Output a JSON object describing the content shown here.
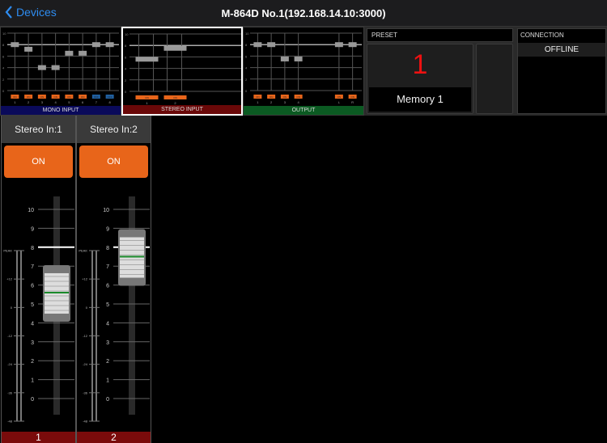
{
  "navbar": {
    "back_label": "Devices",
    "title": "M-864D No.1(192.168.14.10:3000)"
  },
  "overview": {
    "scale_labels": [
      "10",
      "8",
      "6",
      "4",
      "2",
      "0"
    ],
    "panels": [
      {
        "id": "mono",
        "label": "MONO INPUT",
        "color": "#0a0a5a",
        "selected": false,
        "channels": [
          {
            "name": "1",
            "level": 8.0,
            "on": true
          },
          {
            "name": "2",
            "level": 7.2,
            "on": true
          },
          {
            "name": "3",
            "level": 4.0,
            "on": true
          },
          {
            "name": "4",
            "level": 4.0,
            "on": true
          },
          {
            "name": "5",
            "level": 6.5,
            "on": true
          },
          {
            "name": "6",
            "level": 6.5,
            "on": true
          },
          {
            "name": "7",
            "level": 8.0,
            "on": false
          },
          {
            "name": "8",
            "level": 8.0,
            "on": false
          }
        ]
      },
      {
        "id": "stereo",
        "label": "STEREO  INPUT",
        "color": "#6a0808",
        "selected": true,
        "channels": [
          {
            "name": "1",
            "level": 5.6,
            "on": true
          },
          {
            "name": "2",
            "level": 7.5,
            "on": true
          }
        ]
      },
      {
        "id": "output",
        "label": "OUTPUT",
        "color": "#0b5a22",
        "selected": false,
        "channels": [
          {
            "name": "1",
            "level": 8.0,
            "on": true
          },
          {
            "name": "2",
            "level": 8.0,
            "on": true
          },
          {
            "name": "3",
            "level": 5.5,
            "on": true
          },
          {
            "name": "4",
            "level": 5.5,
            "on": true
          },
          {
            "name": "",
            "level": null,
            "on": null
          },
          {
            "name": "",
            "level": null,
            "on": null
          },
          {
            "name": "L",
            "level": 8.0,
            "on": true
          },
          {
            "name": "R",
            "level": 8.0,
            "on": true
          }
        ]
      }
    ],
    "on_label": "ON",
    "off_label": "OFF"
  },
  "preset": {
    "header": "PRESET",
    "number": "1",
    "name": "Memory 1"
  },
  "connection": {
    "header": "CONNECTION",
    "status": "OFFLINE"
  },
  "strips": [
    {
      "name": "Stereo In:1",
      "on_label": "ON",
      "number": "1",
      "fader_level": 5.6
    },
    {
      "name": "Stereo In:2",
      "on_label": "ON",
      "number": "2",
      "fader_level": 7.5
    }
  ],
  "fader_scale": [
    "10",
    "9",
    "8",
    "7",
    "6",
    "5",
    "4",
    "3",
    "2",
    "1",
    "0"
  ],
  "meter_scale": [
    "PEAK",
    "+12",
    "0",
    "-12",
    "-24",
    "-36",
    "-48"
  ]
}
